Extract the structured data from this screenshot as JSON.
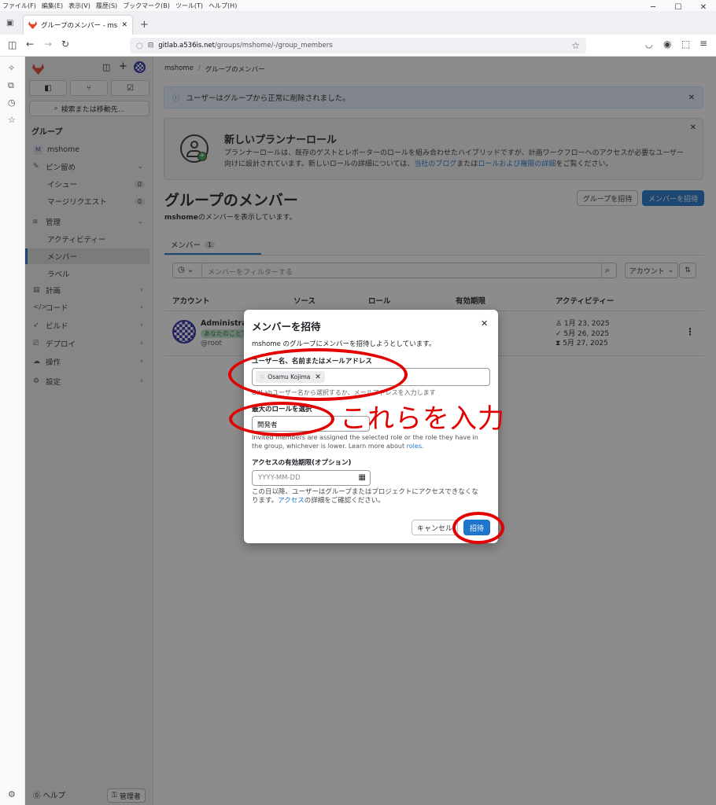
{
  "menubar": [
    "ファイル(F)",
    "編集(E)",
    "表示(V)",
    "履歴(S)",
    "ブックマーク(B)",
    "ツール(T)",
    "ヘルプ(H)"
  ],
  "browser": {
    "tab_title": "グループのメンバー - mshome - GitLab",
    "url_domain": "gitlab.a536is.net",
    "url_path": "/groups/mshome/-/group_members"
  },
  "sidebar": {
    "search": "検索または移動先...",
    "section": "グループ",
    "group_name": "mshome",
    "group_initial": "M",
    "pinned": "ピン留め",
    "issues": "イシュー",
    "issues_count": "0",
    "mrs": "マージリクエスト",
    "mrs_count": "0",
    "manage": "管理",
    "activity": "アクティビティー",
    "members": "メンバー",
    "labels": "ラベル",
    "plan": "計画",
    "code": "コード",
    "build": "ビルド",
    "deploy": "デプロイ",
    "operate": "操作",
    "settings": "設定",
    "help": "ヘルプ",
    "admin": "管理者"
  },
  "breadcrumb": {
    "group": "mshome",
    "sep": "/",
    "page": "グループのメンバー"
  },
  "alert": {
    "text": "ユーザーはグループから正常に削除されました。"
  },
  "banner": {
    "title": "新しいプランナーロール",
    "body1": "プランナーロールは、既存のゲストとレポーターのロールを組み合わせたハイブリッドですが、計画ワークフローへのアクセスが必要なユーザー",
    "body2a": "向けに設計されています。新しいロールの詳細については、",
    "link1": "当社のブログ",
    "body2b": "または",
    "link2": "ロールおよび権限の詳細",
    "body2c": "をご覧ください。"
  },
  "page": {
    "title": "グループのメンバー",
    "subtitle_group": "mshome",
    "subtitle_rest": "のメンバーを表示しています。",
    "invite_group": "グループを招待",
    "invite_member": "メンバーを招待"
  },
  "tabs": {
    "members": "メンバー",
    "members_count": "1"
  },
  "filter": {
    "placeholder": "メンバーをフィルターする",
    "sort": "アカウント"
  },
  "table": {
    "headers": [
      "アカウント",
      "ソース",
      "ロール",
      "有効期限",
      "アクティビティー"
    ],
    "row": {
      "name": "Administrator",
      "badge": "あなたのことです",
      "username": "@root",
      "activity": [
        "1月 23, 2025",
        "5月 26, 2025",
        "5月 27, 2025"
      ]
    }
  },
  "modal": {
    "title": "メンバーを招待",
    "intro": "mshome のグループにメンバーを招待しようとしています。",
    "user_label": "ユーザー名、名前またはメールアドレス",
    "user_token": "Osamu Kojima",
    "user_help": "GitLabユーザー名から選択するか、メールアドレスを入力します",
    "role_label": "最大のロールを選択",
    "role_value": "開発者",
    "role_help1": "Invited members are assigned the selected role or the role they have in",
    "role_help2": "the group, whichever is lower. Learn more about",
    "role_link": "roles",
    "role_help_end": ".",
    "expiry_label": "アクセスの有効期限(オプション)",
    "expiry_placeholder": "YYYY-MM-DD",
    "expiry_help1": "この日以降、ユーザーはグループまたはプロジェクトにアクセスできなくな",
    "expiry_help2a": "ります。",
    "expiry_link": "アクセス",
    "expiry_help2b": "の詳細をご確認ください。",
    "cancel": "キャンセル",
    "invite": "招待"
  },
  "annotation": "これらを入力",
  "colors": {
    "accent": "#1f75cb",
    "annotation": "#e30000",
    "gitlab": "#e24329"
  }
}
